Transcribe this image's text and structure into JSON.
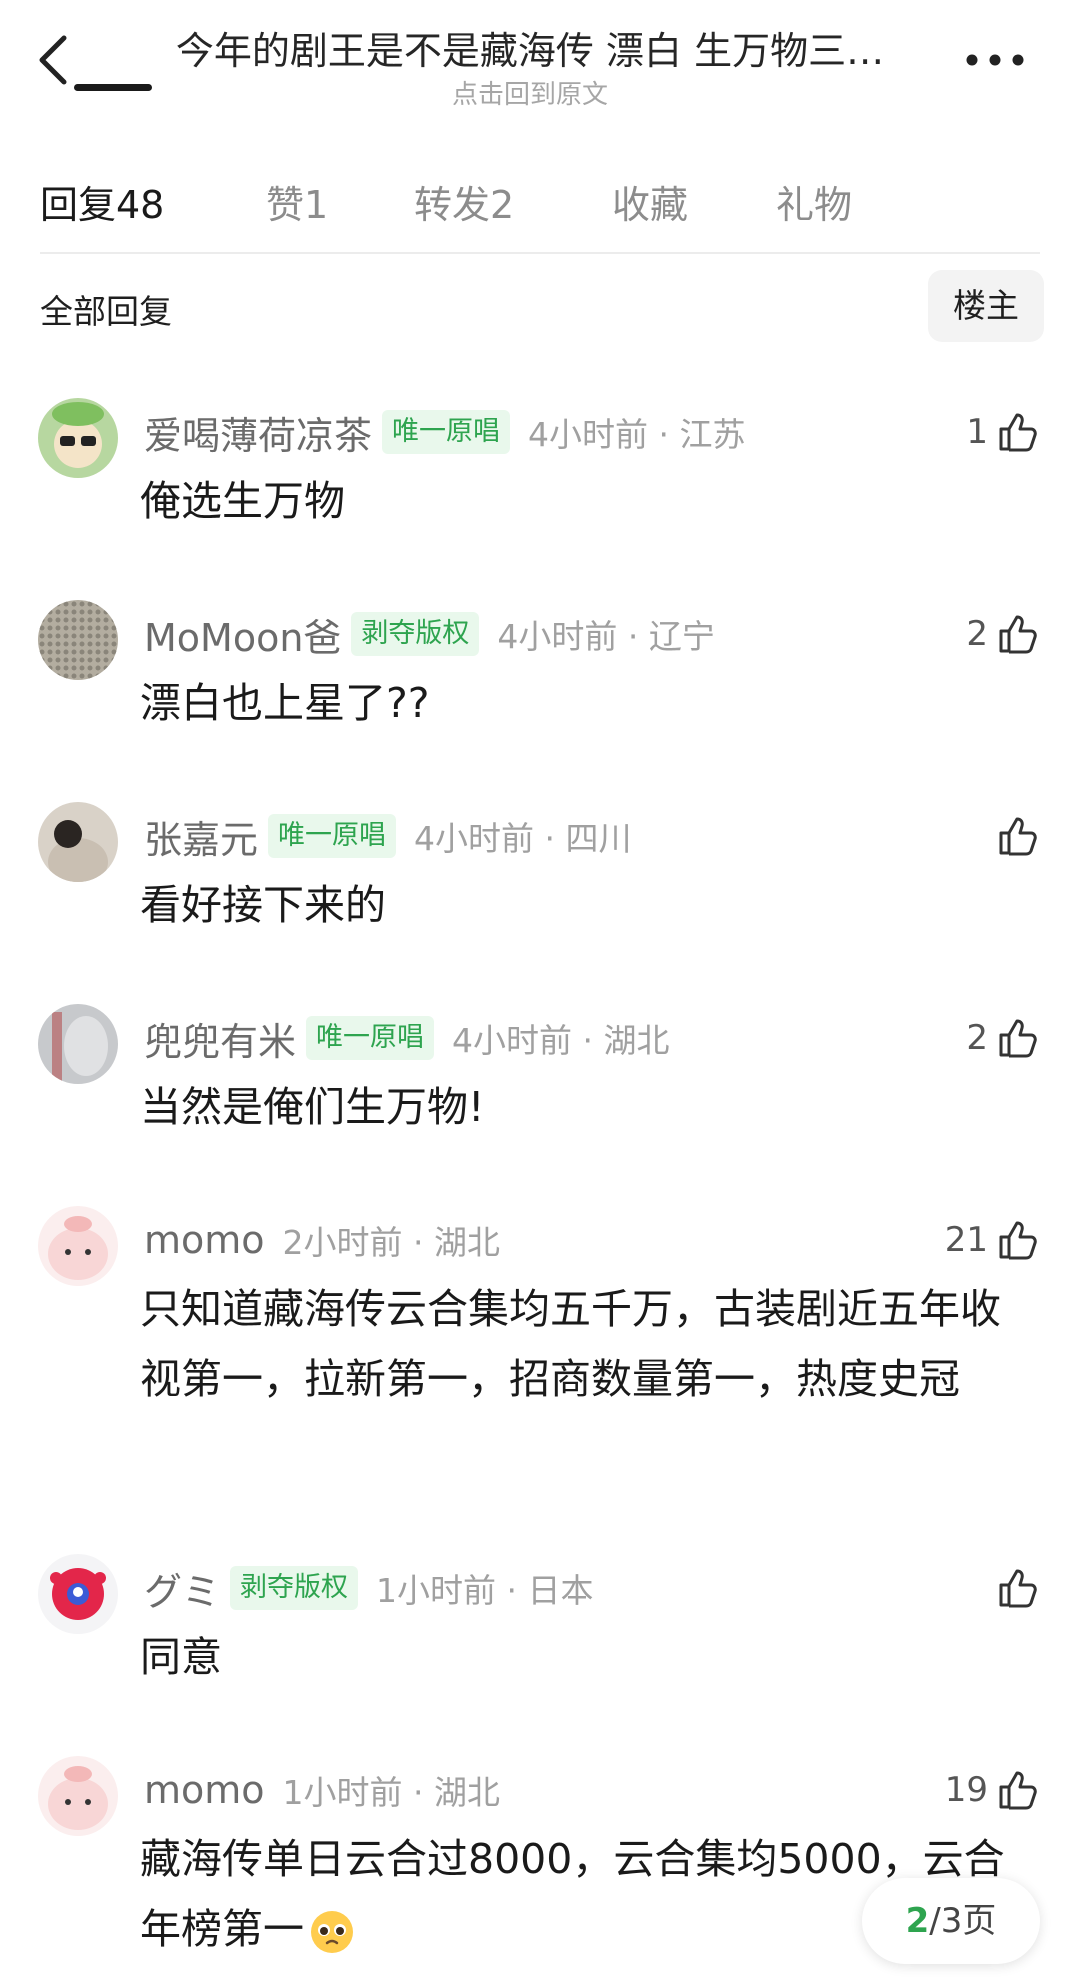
{
  "header": {
    "title": "今年的剧王是不是藏海传 漂白 生万物三…",
    "subtitle": "点击回到原文",
    "back_icon": "chevron-left-icon",
    "more_icon": "more-dots-icon"
  },
  "tabs": [
    {
      "label": "回复48",
      "active": true
    },
    {
      "label": "赞1",
      "active": false
    },
    {
      "label": "转发2",
      "active": false
    },
    {
      "label": "收藏",
      "active": false
    },
    {
      "label": "礼物",
      "active": false
    }
  ],
  "filter": {
    "label": "全部回复",
    "op_button": "楼主"
  },
  "comments": [
    {
      "username": "爱喝薄荷凉茶",
      "badge": "唯一原唱",
      "time": "4小时前 · 江苏",
      "likes": "1",
      "text": "俺选生万物"
    },
    {
      "username": "MoMoon爸",
      "badge": "剥夺版权",
      "time": "4小时前 · 辽宁",
      "likes": "2",
      "text": "漂白也上星了??"
    },
    {
      "username": "张嘉元",
      "badge": "唯一原唱",
      "time": "4小时前 · 四川",
      "likes": "",
      "text": "看好接下来的"
    },
    {
      "username": "兜兜有米",
      "badge": "唯一原唱",
      "time": "4小时前 · 湖北",
      "likes": "2",
      "text": "当然是俺们生万物!"
    },
    {
      "username": "momo",
      "badge": "",
      "time": "2小时前 · 湖北",
      "likes": "21",
      "text": "只知道藏海传云合集均五千万，古装剧近五年收视第一，拉新第一，招商数量第一，热度史冠"
    },
    {
      "username": "グミ",
      "badge": "剥夺版权",
      "time": "1小时前 · 日本",
      "likes": "",
      "text": "同意"
    },
    {
      "username": "momo",
      "badge": "",
      "time": "1小时前 · 湖北",
      "likes": "19",
      "text": "藏海传单日云合过8000，云合集均5000，云合年榜第一"
    }
  ],
  "pager": {
    "current": "2",
    "rest": "/3页"
  },
  "colors": {
    "badge_green": "#2ea44f",
    "badge_bg": "#e9f8ec",
    "meta_gray": "#a0a0a0"
  }
}
